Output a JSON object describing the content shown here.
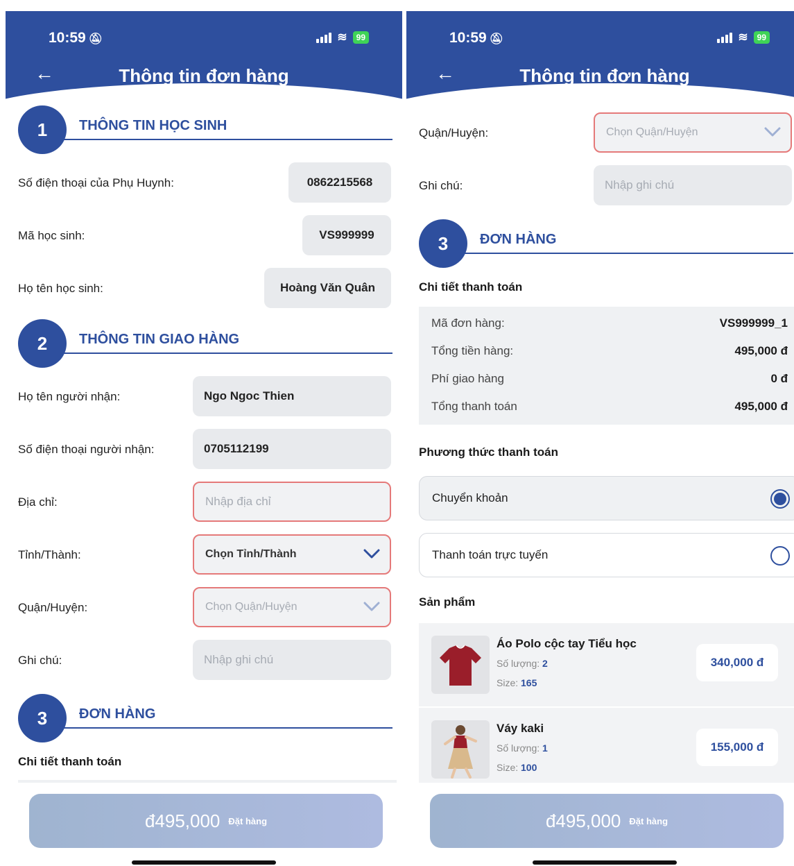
{
  "status": {
    "time": "10:59",
    "battery": "99"
  },
  "header": {
    "title": "Thông tin đơn hàng"
  },
  "sections": {
    "student": {
      "number": "1",
      "title": "THÔNG TIN HỌC SINH"
    },
    "delivery": {
      "number": "2",
      "title": "THÔNG TIN GIAO HÀNG"
    },
    "order": {
      "number": "3",
      "title": "ĐƠN HÀNG"
    }
  },
  "student": {
    "parent_phone_label": "Số điện thoại của Phụ Huynh:",
    "parent_phone": "0862215568",
    "student_id_label": "Mã học sinh:",
    "student_id": "VS999999",
    "student_name_label": "Họ tên học sinh:",
    "student_name": "Hoàng Văn Quân"
  },
  "delivery": {
    "recipient_name_label": "Họ tên người nhận:",
    "recipient_name": "Ngo Ngoc Thien",
    "recipient_phone_label": "Số điện thoại người nhận:",
    "recipient_phone": "0705112199",
    "address_label": "Địa chỉ:",
    "address_placeholder": "Nhập địa chỉ",
    "province_label": "Tỉnh/Thành:",
    "province_placeholder": "Chọn Tỉnh/Thành",
    "district_label": "Quận/Huyện:",
    "district_placeholder": "Chọn Quận/Huyện",
    "note_label": "Ghi chú:",
    "note_placeholder": "Nhập ghi chú"
  },
  "payment": {
    "details_heading": "Chi tiết thanh toán",
    "order_code_label": "Mã đơn hàng:",
    "order_code": "VS999999_1",
    "subtotal_label": "Tổng tiền hàng:",
    "subtotal": "495,000 đ",
    "shipping_label": "Phí giao hàng",
    "shipping": "0 đ",
    "total_label": "Tổng thanh toán",
    "total": "495,000 đ",
    "method_heading": "Phương thức thanh toán",
    "method_transfer": "Chuyển khoản",
    "method_online": "Thanh toán trực tuyến",
    "selected_method": "Chuyển khoản"
  },
  "products": {
    "heading": "Sản phẩm",
    "qty_label": "Số lượng:",
    "size_label": "Size:",
    "items": [
      {
        "name": "Áo Polo cộc tay Tiểu học",
        "quantity": "2",
        "size": "165",
        "price": "340,000 đ"
      },
      {
        "name": "Váy kaki",
        "quantity": "1",
        "size": "100",
        "price": "155,000 đ"
      }
    ]
  },
  "footer": {
    "total": "đ495,000",
    "button_label": "Đặt hàng"
  },
  "colors": {
    "primary": "#2e4f9e",
    "error_border": "#e57979",
    "field_bg": "#e8eaed",
    "battery": "#3fd357"
  }
}
